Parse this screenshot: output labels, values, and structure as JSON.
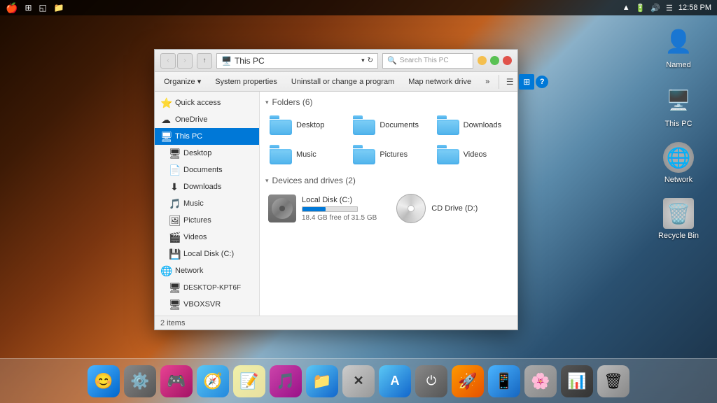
{
  "desktop": {
    "bg": "mountain landscape"
  },
  "menubar": {
    "time": "12:58 PM",
    "icons": [
      "wifi",
      "battery",
      "volume",
      "notification"
    ]
  },
  "desktop_icons": [
    {
      "label": "Named",
      "icon": "👤"
    },
    {
      "label": "This PC",
      "icon": "🖥️"
    },
    {
      "label": "Network",
      "icon": "🌐"
    },
    {
      "label": "Recycle Bin",
      "icon": "🗑️"
    }
  ],
  "explorer": {
    "title": "This PC",
    "address": "This PC",
    "search_placeholder": "Search This PC",
    "toolbar": {
      "organize_label": "Organize ▾",
      "system_properties_label": "System properties",
      "uninstall_label": "Uninstall or change a program",
      "map_network_label": "Map network drive",
      "more_label": "»"
    },
    "sidebar": {
      "quick_access": "Quick access",
      "onedrive": "OneDrive",
      "this_pc": "This PC",
      "items": [
        {
          "label": "Desktop",
          "icon": "🖥"
        },
        {
          "label": "Documents",
          "icon": "📄"
        },
        {
          "label": "Downloads",
          "icon": "⬇"
        },
        {
          "label": "Music",
          "icon": "🎵"
        },
        {
          "label": "Pictures",
          "icon": "🖼"
        },
        {
          "label": "Videos",
          "icon": "🎬"
        },
        {
          "label": "Local Disk (C:)",
          "icon": "💾"
        }
      ],
      "network": "Network",
      "network_items": [
        {
          "label": "DESKTOP-KPT6F",
          "icon": "🖥"
        },
        {
          "label": "VBOXSVR",
          "icon": "🖥"
        }
      ]
    },
    "folders_section": "Folders (6)",
    "folders": [
      {
        "label": "Desktop"
      },
      {
        "label": "Documents"
      },
      {
        "label": "Downloads"
      },
      {
        "label": "Music"
      },
      {
        "label": "Pictures"
      },
      {
        "label": "Videos"
      }
    ],
    "drives_section": "Devices and drives (2)",
    "drives": [
      {
        "label": "Local Disk (C:)",
        "space": "18.4 GB free of 31.5 GB",
        "fill_pct": 42,
        "type": "hdd"
      },
      {
        "label": "CD Drive (D:)",
        "type": "cd"
      }
    ],
    "status": "2 items"
  },
  "dock": {
    "items": [
      {
        "label": "Finder",
        "icon": "😊",
        "class": "dock-finder"
      },
      {
        "label": "System Preferences",
        "icon": "⚙️",
        "class": "dock-settings"
      },
      {
        "label": "Game Center",
        "icon": "🎮",
        "class": "dock-gamecenter"
      },
      {
        "label": "Safari",
        "icon": "🧭",
        "class": "dock-safari"
      },
      {
        "label": "Notes",
        "icon": "📝",
        "class": "dock-notes"
      },
      {
        "label": "iTunes",
        "icon": "🎵",
        "class": "dock-itunes"
      },
      {
        "label": "Finder",
        "icon": "📁",
        "class": "dock-finder2"
      },
      {
        "label": "X",
        "icon": "✕",
        "class": "dock-x"
      },
      {
        "label": "App Store",
        "icon": "A",
        "class": "dock-appstore"
      },
      {
        "label": "Power",
        "icon": "⏻",
        "class": "dock-power"
      },
      {
        "label": "Launchpad",
        "icon": "🚀",
        "class": "dock-rocket"
      },
      {
        "label": "App2",
        "icon": "📱",
        "class": "dock-app2"
      },
      {
        "label": "Photos",
        "icon": "🌸",
        "class": "dock-photos"
      },
      {
        "label": "Monitor",
        "icon": "📊",
        "class": "dock-monitor"
      },
      {
        "label": "Trash",
        "icon": "🗑",
        "class": "dock-trash"
      }
    ]
  }
}
